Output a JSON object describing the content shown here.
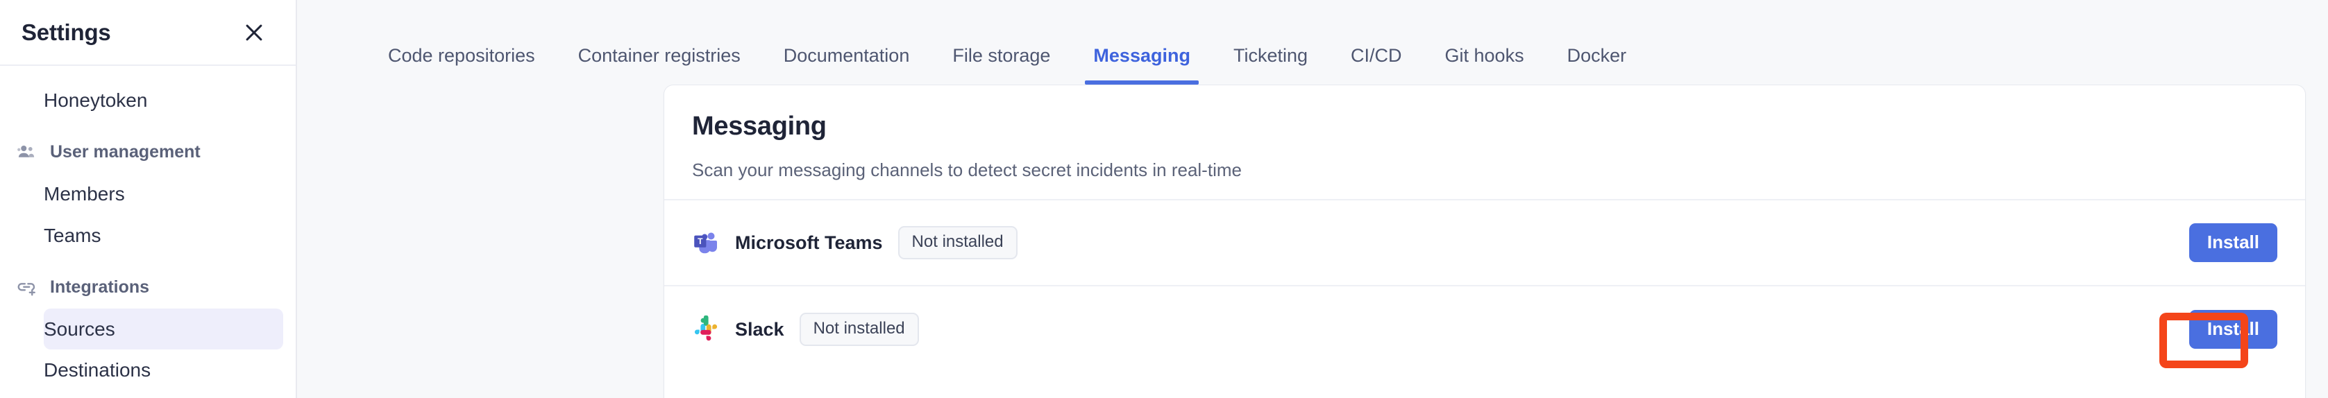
{
  "sidebar": {
    "title": "Settings",
    "close_icon": "close-icon",
    "items": [
      {
        "label": "Honeytoken",
        "type": "link",
        "active": false
      },
      {
        "label": "User management",
        "type": "group",
        "icon": "users-group-icon"
      },
      {
        "label": "Members",
        "type": "link",
        "active": false
      },
      {
        "label": "Teams",
        "type": "link",
        "active": false
      },
      {
        "label": "Integrations",
        "type": "group",
        "icon": "link-plus-icon"
      },
      {
        "label": "Sources",
        "type": "link",
        "active": true
      },
      {
        "label": "Destinations",
        "type": "link",
        "active": false
      }
    ]
  },
  "tabs": [
    {
      "label": "Code repositories",
      "active": false
    },
    {
      "label": "Container registries",
      "active": false
    },
    {
      "label": "Documentation",
      "active": false
    },
    {
      "label": "File storage",
      "active": false
    },
    {
      "label": "Messaging",
      "active": true
    },
    {
      "label": "Ticketing",
      "active": false
    },
    {
      "label": "CI/CD",
      "active": false
    },
    {
      "label": "Git hooks",
      "active": false
    },
    {
      "label": "Docker",
      "active": false
    }
  ],
  "card": {
    "title": "Messaging",
    "subtitle": "Scan your messaging channels to detect secret incidents in real-time",
    "rows": [
      {
        "name": "Microsoft Teams",
        "logo": "microsoft-teams-logo",
        "status": "Not installed",
        "action": "Install",
        "highlighted": false
      },
      {
        "name": "Slack",
        "logo": "slack-logo",
        "status": "Not installed",
        "action": "Install",
        "highlighted": true
      }
    ]
  },
  "colors": {
    "accent": "#4a6fe0",
    "tab_active": "#3e63dd",
    "sidebar_active_bg": "#eeeefb",
    "highlight": "#f4451a",
    "page_bg": "#f7f8fa"
  }
}
